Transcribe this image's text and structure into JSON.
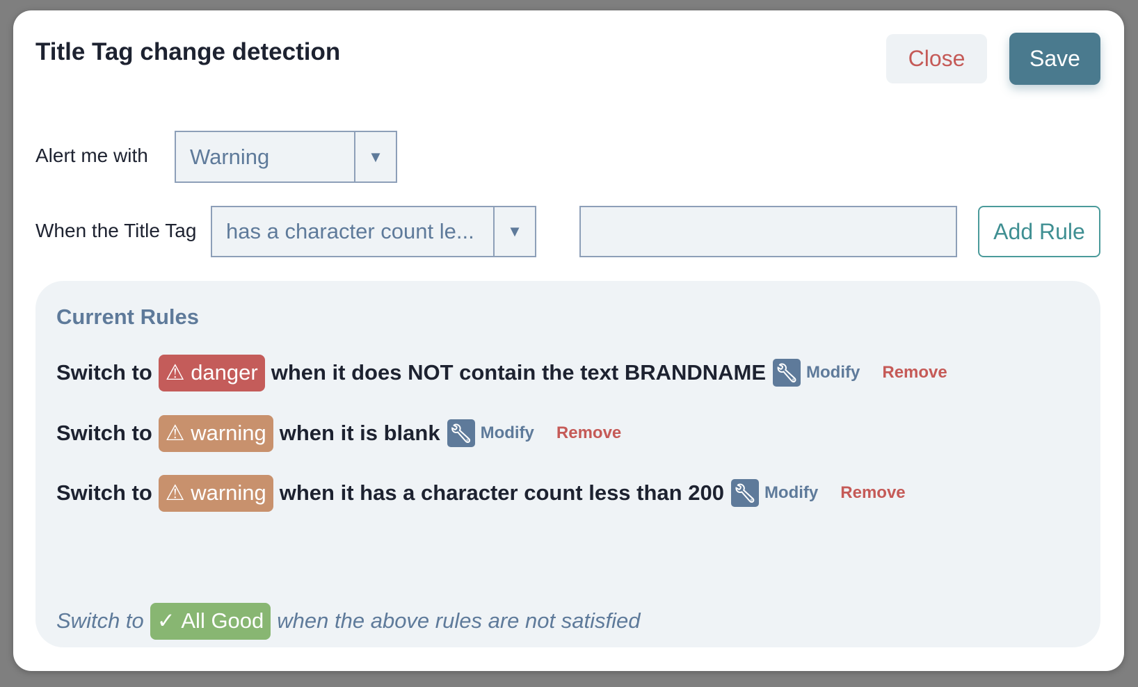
{
  "modal": {
    "title": "Title Tag change detection",
    "close_label": "Close",
    "save_label": "Save"
  },
  "form": {
    "alert_label": "Alert me with",
    "alert_value": "Warning",
    "when_label": "When the Title Tag",
    "condition_value": "has a character count le...",
    "text_value": "",
    "add_rule_label": "Add Rule"
  },
  "rules": {
    "title": "Current Rules",
    "items": [
      {
        "prefix": "Switch to",
        "level": "danger",
        "condition": "when it does NOT contain the text BRANDNAME",
        "modify": "Modify",
        "remove": "Remove"
      },
      {
        "prefix": "Switch to",
        "level": "warning",
        "condition": "when it is blank",
        "modify": "Modify",
        "remove": "Remove"
      },
      {
        "prefix": "Switch to",
        "level": "warning",
        "condition": "when it has a character count less than 200",
        "modify": "Modify",
        "remove": "Remove"
      }
    ],
    "default": {
      "prefix": "Switch to",
      "level": "All Good",
      "condition": "when the above rules are not satisfied"
    }
  },
  "colors": {
    "danger": "#c45c5a",
    "warning": "#c8916d",
    "good": "#88b672",
    "primary": "#4a7a8e",
    "muted": "#5e7a9a"
  }
}
